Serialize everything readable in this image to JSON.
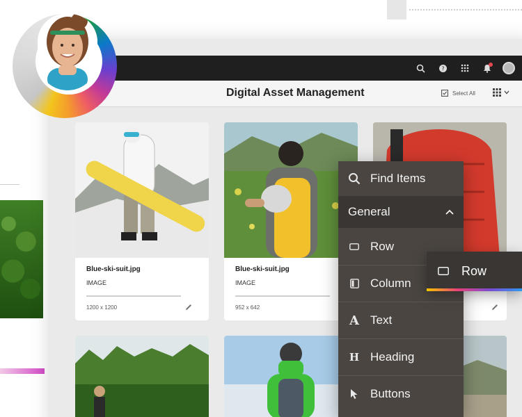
{
  "app": {
    "title": "Digital Asset Management",
    "select_all_label": "Select All",
    "notification_color": "#e34850"
  },
  "topbar": {
    "icons": [
      "search-icon",
      "help-icon",
      "apps-grid-icon",
      "bell-icon",
      "user-avatar"
    ]
  },
  "cards": [
    {
      "name": "Blue-ski-suit.jpg",
      "type": "IMAGE",
      "dims": "1200 x 1200",
      "image": "person-with-snowboard"
    },
    {
      "name": "Blue-ski-suit.jpg",
      "type": "IMAGE",
      "dims": "952 x 642",
      "image": "hiker-with-backpack"
    },
    {
      "name": "",
      "type": "",
      "dims": "",
      "image": "person-in-red-jacket"
    }
  ],
  "menu": {
    "find_items": "Find Items",
    "general": "General",
    "items": [
      {
        "label": "Row",
        "icon": "row-icon"
      },
      {
        "label": "Column",
        "icon": "column-icon"
      },
      {
        "label": "Text",
        "icon": "text-icon"
      },
      {
        "label": "Heading",
        "icon": "heading-icon"
      },
      {
        "label": "Buttons",
        "icon": "pointer-icon"
      }
    ]
  },
  "drag_item": {
    "label": "Row"
  },
  "colors": {
    "topbar": "#1f1f1f",
    "menu_bg": "#4a4541",
    "menu_active": "#3a3633"
  }
}
